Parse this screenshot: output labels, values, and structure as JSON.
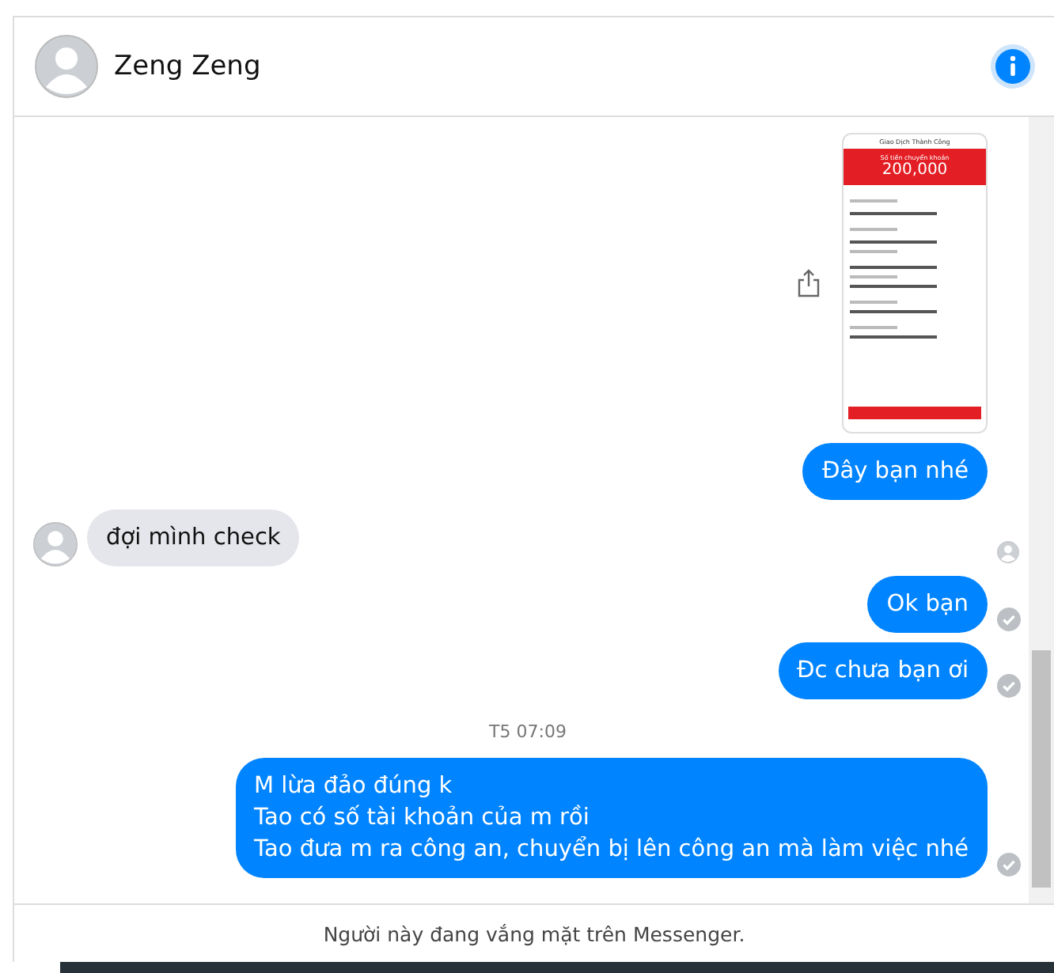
{
  "header": {
    "name": "Zeng Zeng"
  },
  "messages": [
    {
      "kind": "image",
      "receipt": {
        "title": "Giao Dịch Thành Công",
        "amount_label": "Số tiền chuyển khoản",
        "amount": "200,000"
      }
    },
    {
      "kind": "text",
      "outgoing": true,
      "text": "Đây bạn nhé"
    },
    {
      "kind": "text",
      "outgoing": false,
      "text": "đợi mình check",
      "seen": true
    },
    {
      "kind": "text",
      "outgoing": true,
      "text": "Ok bạn",
      "delivered": true
    },
    {
      "kind": "text",
      "outgoing": true,
      "text": "Đc chưa bạn ơi",
      "delivered": true
    },
    {
      "kind": "time",
      "text": "T5 07:09"
    },
    {
      "kind": "text",
      "outgoing": true,
      "text": "M lừa đảo đúng k\nTao có số tài khoản của m rồi\nTao đưa m ra công an, chuyển bị lên công an mà làm việc nhé",
      "delivered": true
    }
  ],
  "footer": {
    "text": "Người này đang vắng mặt trên Messenger."
  }
}
